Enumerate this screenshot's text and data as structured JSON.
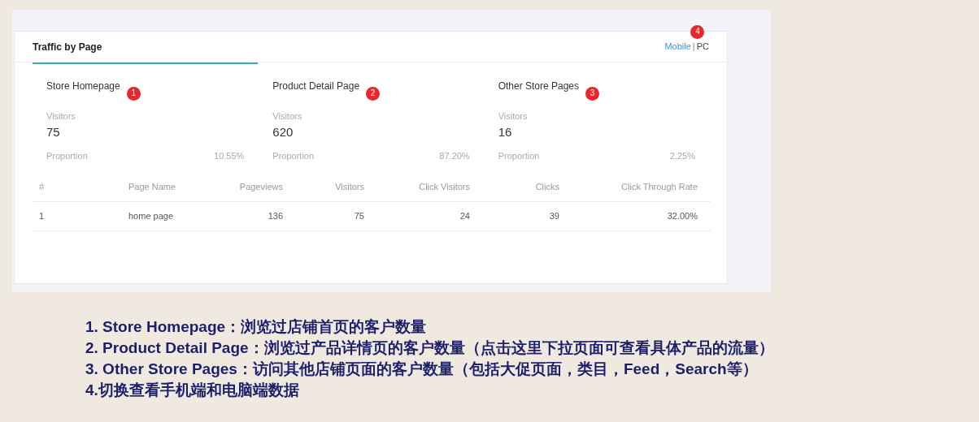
{
  "card": {
    "title": "Traffic by Page",
    "toggle": {
      "options": [
        {
          "label": "Mobile",
          "selected": true
        },
        {
          "label": "PC",
          "selected": false
        }
      ],
      "separator": "|",
      "badge": "4"
    },
    "tabs": [
      {
        "label": "Store Homepage",
        "badge": "1",
        "selected": true,
        "visitors_label": "Visitors",
        "visitors": "75",
        "proportion_label": "Proportion",
        "proportion": "10.55%"
      },
      {
        "label": "Product Detail Page",
        "badge": "2",
        "selected": false,
        "visitors_label": "Visitors",
        "visitors": "620",
        "proportion_label": "Proportion",
        "proportion": "87.20%"
      },
      {
        "label": "Other Store Pages",
        "badge": "3",
        "selected": false,
        "visitors_label": "Visitors",
        "visitors": "16",
        "proportion_label": "Proportion",
        "proportion": "2.25%"
      }
    ],
    "table": {
      "columns": [
        "#",
        "Page Name",
        "Pageviews",
        "Visitors",
        "Click Visitors",
        "Clicks",
        "Click Through Rate"
      ],
      "rows": [
        [
          "1",
          "home page",
          "136",
          "75",
          "24",
          "39",
          "32.00%"
        ]
      ]
    }
  },
  "notes": [
    "1. Store Homepage：浏览过店铺首页的客户数量",
    "2. Product Detail Page：浏览过产品详情页的客户数量（点击这里下拉页面可查看具体产品的流量）",
    "3. Other Store Pages：访问其他店铺页面的客户数量（包括大促页面，类目，Feed，Search等）",
    "4.切换查看手机端和电脑端数据"
  ]
}
